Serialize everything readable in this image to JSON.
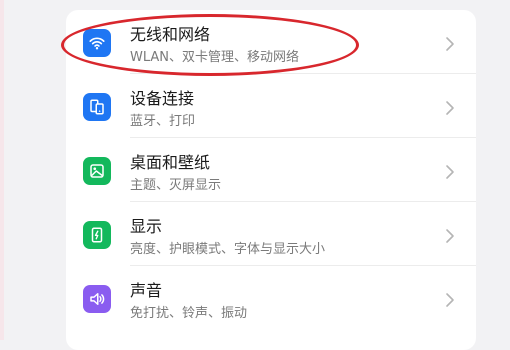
{
  "settings": {
    "items": [
      {
        "title": "无线和网络",
        "subtitle": "WLAN、双卡管理、移动网络",
        "icon": "wifi-icon",
        "color": "#1f76f3"
      },
      {
        "title": "设备连接",
        "subtitle": "蓝牙、打印",
        "icon": "device-connection-icon",
        "color": "#1f76f3"
      },
      {
        "title": "桌面和壁纸",
        "subtitle": "主题、灭屏显示",
        "icon": "wallpaper-icon",
        "color": "#13b85c"
      },
      {
        "title": "显示",
        "subtitle": "亮度、护眼模式、字体与显示大小",
        "icon": "display-brightness-icon",
        "color": "#13b85c"
      },
      {
        "title": "声音",
        "subtitle": "免打扰、铃声、振动",
        "icon": "sound-icon",
        "color": "#8a5cf0"
      }
    ],
    "chevron": "chevron-right-icon",
    "annotation_color": "#d8272d"
  }
}
